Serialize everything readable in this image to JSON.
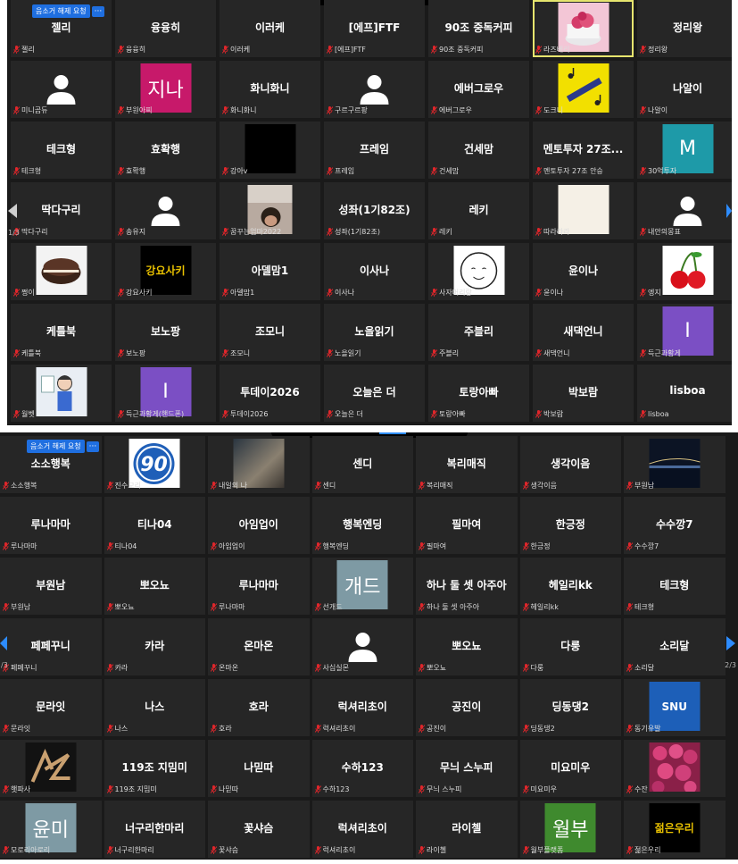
{
  "panels": [
    {
      "unmute_label": "음소거 해제 요청",
      "more_label": "···",
      "page": "1/3",
      "tiles": [
        {
          "name": "젤리",
          "label": "젤리"
        },
        {
          "name": "융융히",
          "label": "융융히"
        },
        {
          "name": "이러케",
          "label": "이러케"
        },
        {
          "name": "[에프]FTF",
          "label": "[에프]FTF"
        },
        {
          "name": "90조 중독커피",
          "label": "90조 중독커피"
        },
        {
          "name": "",
          "label": "라즈베리",
          "avatar": "cake",
          "highlight": true
        },
        {
          "name": "정리왕",
          "label": "정리왕"
        },
        {
          "name": "",
          "label": "미니곰듀",
          "avatar": "person",
          "bg": "#0f5a52"
        },
        {
          "name": "",
          "label": "부원아찌",
          "avatar": "text",
          "text": "지나",
          "bg": "#c7196a"
        },
        {
          "name": "화니화니",
          "label": "화니화니"
        },
        {
          "name": "",
          "label": "구르구르팡",
          "avatar": "person",
          "bg": "#1a6fc4"
        },
        {
          "name": "에버그로우",
          "label": "에버그로우"
        },
        {
          "name": "",
          "label": "도크니",
          "avatar": "music",
          "bg": "#f2e000"
        },
        {
          "name": "나알이",
          "label": "나알이"
        },
        {
          "name": "테크형",
          "label": "테크형"
        },
        {
          "name": "효확행",
          "label": "효확행"
        },
        {
          "name": "",
          "label": "강아v",
          "avatar": "black"
        },
        {
          "name": "프레임",
          "label": "프레임"
        },
        {
          "name": "건세맘",
          "label": "건세맘"
        },
        {
          "name": "멘토투자 27조...",
          "label": "멘토투자 27조 안승"
        },
        {
          "name": "",
          "label": "30억투자",
          "avatar": "text",
          "text": "M",
          "bg": "#1e9aa8"
        },
        {
          "name": "딱다구리",
          "label": "딱다구리"
        },
        {
          "name": "",
          "label": "송유지",
          "avatar": "person",
          "bg": "#f07a0f"
        },
        {
          "name": "",
          "label": "꿈꾸는엄마2022",
          "avatar": "photo",
          "bg": "#8a7a70"
        },
        {
          "name": "성좌(1기82조)",
          "label": "성좌(1기82조)"
        },
        {
          "name": "레키",
          "label": "레키"
        },
        {
          "name": "",
          "label": "따라라라",
          "avatar": "blank",
          "bg": "#f5f0e6"
        },
        {
          "name": "",
          "label": "내안의몽표",
          "avatar": "person",
          "bg": "#b04fc8"
        },
        {
          "name": "",
          "label": "쩡이",
          "avatar": "choco",
          "bg": "#f3f3f3"
        },
        {
          "name": "",
          "label": "강요사키",
          "avatar": "text",
          "text": "강요사키",
          "bg": "#000000",
          "color": "#e8c000",
          "small": true
        },
        {
          "name": "아델맘1",
          "label": "아델맘1"
        },
        {
          "name": "이사나",
          "label": "이사나"
        },
        {
          "name": "",
          "label": "사자머리랑",
          "avatar": "sketch",
          "bg": "#ffffff"
        },
        {
          "name": "윤이나",
          "label": "윤이나"
        },
        {
          "name": "",
          "label": "엥지",
          "avatar": "cherry",
          "bg": "#ffffff"
        },
        {
          "name": "케틀북",
          "label": "케틀북"
        },
        {
          "name": "보노팡",
          "label": "보노팡"
        },
        {
          "name": "조모니",
          "label": "조모니"
        },
        {
          "name": "노을읽기",
          "label": "노을읽기"
        },
        {
          "name": "주블리",
          "label": "주블리"
        },
        {
          "name": "새댁언니",
          "label": "새댁언니"
        },
        {
          "name": "",
          "label": "득근과황게",
          "avatar": "text",
          "text": "I",
          "bg": "#7b4fc4"
        },
        {
          "name": "",
          "label": "월벳",
          "avatar": "cartoon",
          "bg": "#e9eef4"
        },
        {
          "name": "",
          "label": "득근과황게(핸드폰)",
          "avatar": "text",
          "text": "I",
          "bg": "#7b4fc4"
        },
        {
          "name": "투데이2026",
          "label": "투데이2026"
        },
        {
          "name": "오늘은 더",
          "label": "오늘은 더"
        },
        {
          "name": "토랑아빠",
          "label": "토랑아빠"
        },
        {
          "name": "박보람",
          "label": "박보람"
        },
        {
          "name": "lisboa",
          "label": "lisboa"
        }
      ]
    },
    {
      "unmute_label": "음소거 해제 요청",
      "more_label": "···",
      "page": "2/3",
      "page_left": "/3",
      "tiles": [
        {
          "name": "소소행복",
          "label": "소소행복"
        },
        {
          "name": "",
          "label": "진수모리",
          "avatar": "logo90",
          "bg": "#ffffff"
        },
        {
          "name": "",
          "label": "내일의 나",
          "avatar": "sky",
          "bg": "#4a5560"
        },
        {
          "name": "센디",
          "label": "센디"
        },
        {
          "name": "복리매직",
          "label": "복리매직"
        },
        {
          "name": "생각이음",
          "label": "생각이음"
        },
        {
          "name": "",
          "label": "부원남",
          "avatar": "night",
          "bg": "#101828"
        },
        {
          "name": "루나마마",
          "label": "루나마마"
        },
        {
          "name": "티나04",
          "label": "티나04"
        },
        {
          "name": "아임업이",
          "label": "아임업이"
        },
        {
          "name": "행복엔딩",
          "label": "행복엔딩"
        },
        {
          "name": "필마여",
          "label": "필마여"
        },
        {
          "name": "한긍정",
          "label": "한긍정"
        },
        {
          "name": "수수깡7",
          "label": "수수깡7"
        },
        {
          "name": "부원남",
          "label": "부원남"
        },
        {
          "name": "뽀오뇨",
          "label": "뽀오뇨"
        },
        {
          "name": "루나마마",
          "label": "루나마마"
        },
        {
          "name": "",
          "label": "선개드",
          "avatar": "text",
          "text": "개드",
          "bg": "#7e9aa4"
        },
        {
          "name": "하나 둘 셋 아주아",
          "label": "하나 둘 셋 아주아"
        },
        {
          "name": "헤일리kk",
          "label": "헤일리kk"
        },
        {
          "name": "테크형",
          "label": "테크형"
        },
        {
          "name": "페페꾸니",
          "label": "페페꾸니"
        },
        {
          "name": "카라",
          "label": "카라"
        },
        {
          "name": "온마온",
          "label": "온마온"
        },
        {
          "name": "",
          "label": "사십실몬",
          "avatar": "person",
          "bg": "#6b3e2a"
        },
        {
          "name": "뽀오뇨",
          "label": "뽀오뇨"
        },
        {
          "name": "다룽",
          "label": "다룽"
        },
        {
          "name": "소리달",
          "label": "소리달"
        },
        {
          "name": "문라잇",
          "label": "문라잇"
        },
        {
          "name": "나스",
          "label": "나스"
        },
        {
          "name": "호라",
          "label": "호라"
        },
        {
          "name": "럭셔리초이",
          "label": "럭셔리초이"
        },
        {
          "name": "공진이",
          "label": "공진이"
        },
        {
          "name": "딩동댕2",
          "label": "딩동댕2"
        },
        {
          "name": "",
          "label": "동기유발",
          "avatar": "text",
          "text": "SNU",
          "bg": "#1d5fb8",
          "small": true
        },
        {
          "name": "",
          "label": "햇파사",
          "avatar": "azlogo",
          "bg": "#121212"
        },
        {
          "name": "119조 지밈미",
          "label": "119조 지밈미"
        },
        {
          "name": "나믿따",
          "label": "나믿따"
        },
        {
          "name": "수하123",
          "label": "수하123"
        },
        {
          "name": "무늬 스누피",
          "label": "무늬 스누피"
        },
        {
          "name": "미요미우",
          "label": "미요미우"
        },
        {
          "name": "",
          "label": "수잔",
          "avatar": "roses",
          "bg": "#a0305a"
        },
        {
          "name": "",
          "label": "모로리아로리",
          "avatar": "text",
          "text": "윤미",
          "bg": "#7e9aa4"
        },
        {
          "name": "너구리한마리",
          "label": "너구리한마리"
        },
        {
          "name": "꽃샤슴",
          "label": "꽃샤슴"
        },
        {
          "name": "럭셔리초이",
          "label": "럭셔리초이"
        },
        {
          "name": "라이첼",
          "label": "라이첼"
        },
        {
          "name": "",
          "label": "월부플랫폼",
          "avatar": "text",
          "text": "월부",
          "bg": "#3f8a2e"
        },
        {
          "name": "",
          "label": "젊은우리",
          "avatar": "text",
          "text": "젊은우리",
          "bg": "#000000",
          "color": "#e8c000",
          "small": true
        }
      ]
    }
  ],
  "colors": {
    "mute": "#e0262b",
    "tile": "#262626",
    "panel": "#1a1a1a",
    "accent": "#2d8cff",
    "highlight": "#e6e56e"
  }
}
